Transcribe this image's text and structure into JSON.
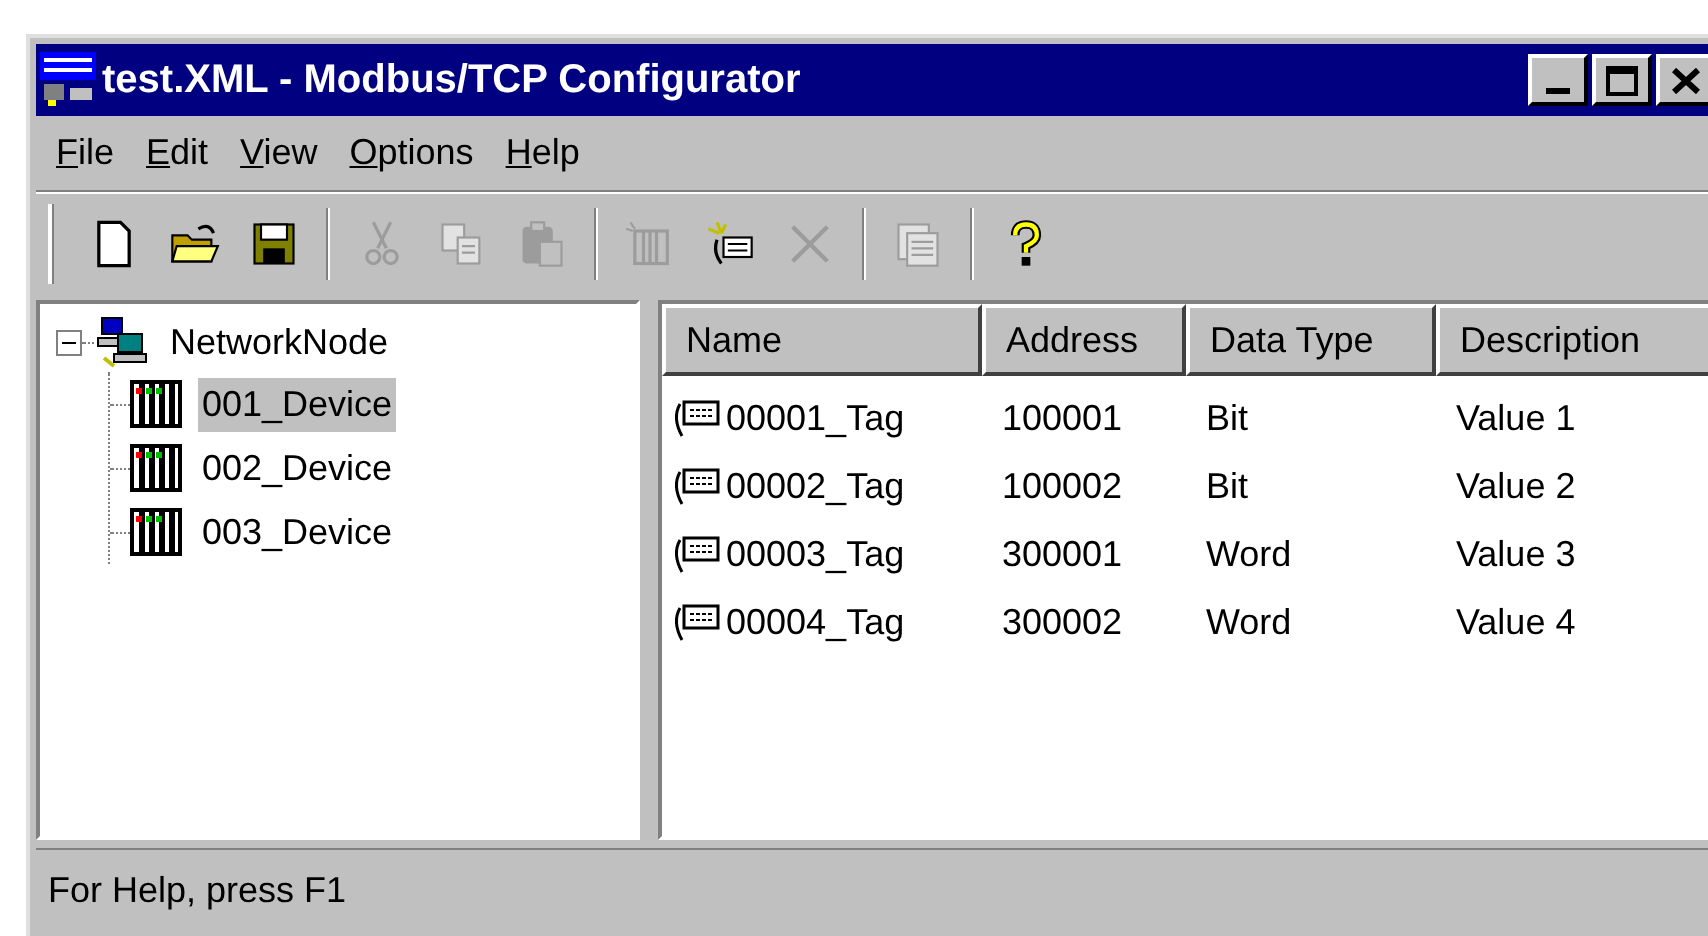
{
  "window": {
    "title": "test.XML - Modbus/TCP Configurator"
  },
  "menu": [
    {
      "label": "File",
      "underline_first": true
    },
    {
      "label": "Edit",
      "underline_first": true
    },
    {
      "label": "View",
      "underline_first": true
    },
    {
      "label": "Options",
      "underline_first": true
    },
    {
      "label": "Help",
      "underline_first": true
    }
  ],
  "toolbar": [
    {
      "kind": "new",
      "disabled": false
    },
    {
      "kind": "open",
      "disabled": false
    },
    {
      "kind": "save",
      "disabled": false
    },
    {
      "kind": "separator"
    },
    {
      "kind": "cut",
      "disabled": true
    },
    {
      "kind": "copy",
      "disabled": true
    },
    {
      "kind": "paste",
      "disabled": true
    },
    {
      "kind": "separator"
    },
    {
      "kind": "new-device",
      "disabled": true
    },
    {
      "kind": "new-tag",
      "disabled": false
    },
    {
      "kind": "delete",
      "disabled": true
    },
    {
      "kind": "separator"
    },
    {
      "kind": "properties",
      "disabled": true
    },
    {
      "kind": "separator"
    },
    {
      "kind": "help",
      "disabled": false
    }
  ],
  "tree": {
    "label": "NetworkNode",
    "expanded": true,
    "children": [
      {
        "label": "001_Device",
        "selected": true
      },
      {
        "label": "002_Device",
        "selected": false
      },
      {
        "label": "003_Device",
        "selected": false
      }
    ]
  },
  "table": {
    "columns": [
      "Name",
      "Address",
      "Data Type",
      "Description"
    ],
    "rows": [
      [
        "00001_Tag",
        "100001",
        "Bit",
        "Value 1"
      ],
      [
        "00002_Tag",
        "100002",
        "Bit",
        "Value 2"
      ],
      [
        "00003_Tag",
        "300001",
        "Word",
        "Value 3"
      ],
      [
        "00004_Tag",
        "300002",
        "Word",
        "Value 4"
      ]
    ]
  },
  "status_bar": "For Help, press F1"
}
